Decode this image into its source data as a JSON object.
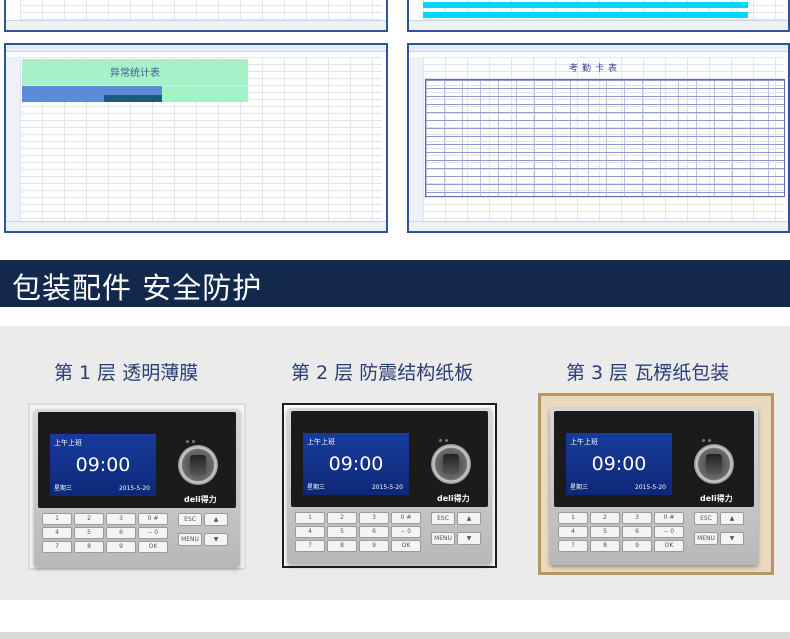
{
  "banner": {
    "title": "包装配件  安全防护"
  },
  "layers": [
    {
      "title": "第 1 层  透明薄膜"
    },
    {
      "title": "第 2 层  防震结构纸板"
    },
    {
      "title": "第 3 层  瓦楞纸包装"
    }
  ],
  "device": {
    "screen_title": "上午上班",
    "time": "09:00",
    "day": "星期三",
    "date": "2015-5-20",
    "brand": "deli得力",
    "keys": [
      "1",
      "2",
      "3",
      "0 #",
      "4",
      "5",
      "6",
      "-- 0",
      "7",
      "8",
      "9",
      "OK"
    ],
    "fkeys": [
      "ESC",
      "▲",
      "MENU",
      "▼"
    ]
  },
  "sheets": {
    "left_title": "异常统计表",
    "right_title": "考勤卡表"
  },
  "colors": {
    "banner": "#13284d",
    "panel": "#ebebeb",
    "title_text": "#2a3d74",
    "frame_1": "#dcdcdc",
    "frame_3": "#b99563",
    "screen": "#183b9c"
  }
}
